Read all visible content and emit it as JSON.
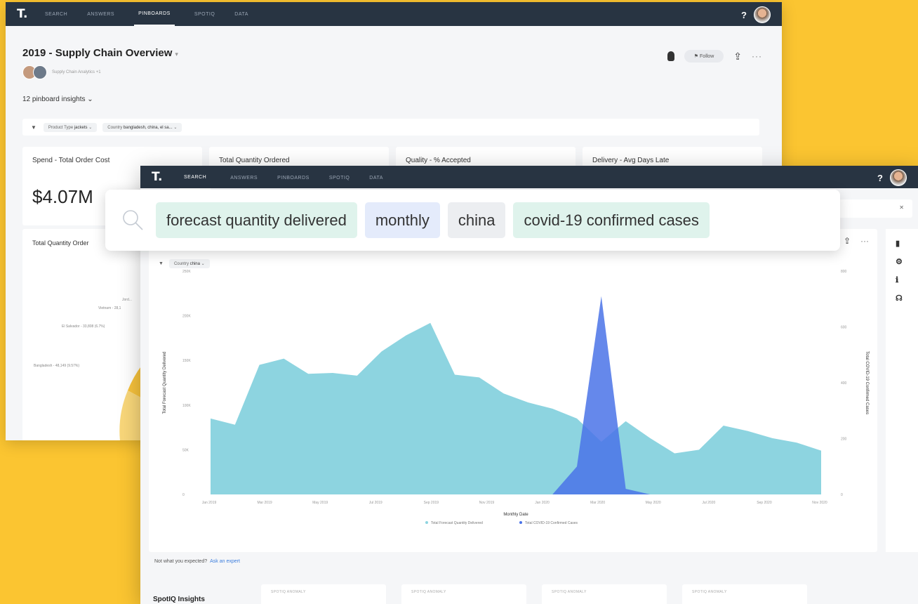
{
  "back": {
    "nav": [
      "SEARCH",
      "ANSWERS",
      "PINBOARDS",
      "SPOTIQ",
      "DATA"
    ],
    "nav_active": 2,
    "help": "?",
    "title": "2019 - Supply Chain Overview",
    "title_caret": "▾",
    "authors": "Supply Chain Analytics +1",
    "follow_label": "Follow",
    "insights_count": "12 pinboard insights ⌄",
    "filters": [
      {
        "key": "Product Type",
        "value": "jackets"
      },
      {
        "key": "Country",
        "value": "bangladesh, china, el sa..."
      }
    ],
    "kpis": [
      {
        "label": "Spend - Total Order Cost",
        "value": "$4.07M"
      },
      {
        "label": "Total Quantity Ordered",
        "value": ""
      },
      {
        "label": "Quality - % Accepted",
        "value": ""
      },
      {
        "label": "Delivery - Avg Days Late",
        "value": ""
      }
    ],
    "chart_title": "Total Quantity Order",
    "pie_labels": [
      "Jord...",
      "Vietnam - 28,1",
      "El Salvador - 33,808 (6.7%)",
      "Bangladesh - 48,149 (9.57%)"
    ]
  },
  "front": {
    "nav": [
      "SEARCH",
      "ANSWERS",
      "PINBOARDS",
      "SPOTIQ",
      "DATA"
    ],
    "nav_active": 0,
    "help": "?",
    "chart_filter": {
      "key": "Country",
      "value": "china"
    },
    "expect_text": "Not what you expected?",
    "expect_link": "Ask an expert",
    "spotiq_title": "SpotIQ Insights",
    "spot_cards": [
      "SPOTIQ ANOMALY",
      "SPOTIQ ANOMALY",
      "SPOTIQ ANOMALY",
      "SPOTIQ ANOMALY"
    ]
  },
  "search_tokens": [
    {
      "text": "forecast quantity delivered",
      "bg": "#dff3ec"
    },
    {
      "text": "monthly",
      "bg": "#e4ebfb"
    },
    {
      "text": "china",
      "bg": "#eceef1"
    },
    {
      "text": "covid-19 confirmed cases",
      "bg": "#dff3ec"
    }
  ],
  "chart_data": {
    "type": "area",
    "xlabel": "Monthly Date",
    "ylabel": "Total Forecast Quantity Delivered",
    "y2label": "Total COVID-19 Confirmed Cases",
    "x_ticks": [
      "Jan 2019",
      "Mar 2019",
      "May 2019",
      "Jul 2019",
      "Sep 2019",
      "Nov 2019",
      "Jan 2020",
      "Mar 2020",
      "May 2020",
      "Jul 2020",
      "Sep 2020",
      "Nov 2020"
    ],
    "y_ticks": [
      "0",
      "50K",
      "100K",
      "150K",
      "200K",
      "250K"
    ],
    "y2_ticks": [
      "0",
      "200",
      "400",
      "600",
      "800"
    ],
    "ylim": [
      0,
      250000
    ],
    "y2lim": [
      0,
      800
    ],
    "colors": {
      "forecast": "#8dd4e0",
      "covid": "#4a73e8"
    },
    "series": [
      {
        "name": "Total Forecast Quantity Delivered",
        "axis": "left",
        "values": [
          85000,
          78000,
          145000,
          152000,
          135000,
          136000,
          133000,
          160000,
          178000,
          192000,
          134000,
          131000,
          113000,
          103000,
          96000,
          85000,
          59000,
          82000,
          63000,
          46000,
          50000,
          77000,
          71000,
          63000,
          58000,
          49000
        ]
      },
      {
        "name": "Total COVID-19 Confirmed Cases",
        "axis": "right",
        "values": [
          0,
          0,
          0,
          0,
          0,
          0,
          0,
          0,
          0,
          0,
          0,
          0,
          0,
          0,
          0,
          100,
          710,
          20,
          0,
          0,
          0,
          0,
          0,
          0,
          0,
          0
        ]
      }
    ]
  }
}
